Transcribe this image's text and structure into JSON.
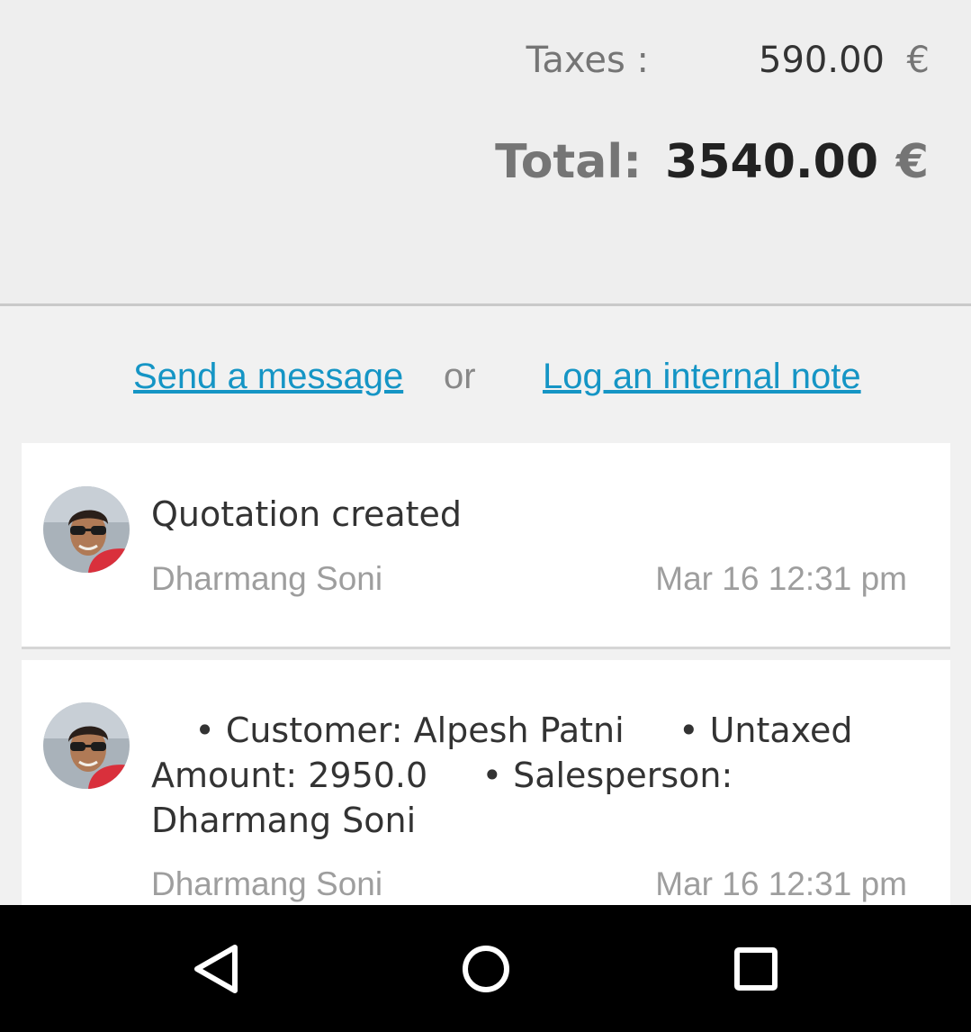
{
  "totals": {
    "taxes_label": "Taxes :",
    "taxes_value": "590.00",
    "total_label": "Total:",
    "total_value": "3540.00",
    "currency": "€"
  },
  "chatter": {
    "send_message_label": "Send a message",
    "or_label": "or",
    "log_note_label": "Log an internal note"
  },
  "messages": [
    {
      "body": "Quotation created",
      "author": "Dharmang Soni",
      "date": "Mar 16 12:31 pm",
      "avatar_icon": "user-avatar"
    },
    {
      "tracking": [
        "Customer: Alpesh Patni",
        "Untaxed Amount: 2950.0",
        "Salesperson: Dharmang Soni"
      ],
      "author": "Dharmang Soni",
      "date": "Mar 16 12:31 pm",
      "avatar_icon": "user-avatar"
    }
  ],
  "navbar": {
    "back_icon": "back-triangle-icon",
    "home_icon": "home-circle-icon",
    "recents_icon": "recents-square-icon"
  },
  "colors": {
    "link": "#1595c5",
    "background": "#eeeeee",
    "card": "#ffffff",
    "navbar": "#000000"
  }
}
